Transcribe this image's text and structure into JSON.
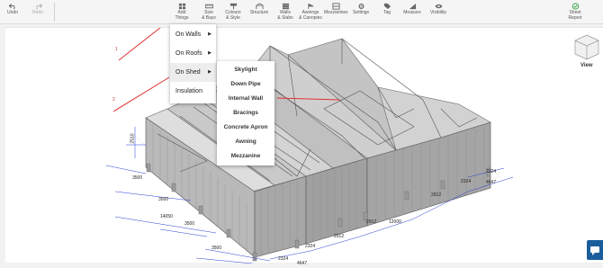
{
  "toolbar": {
    "undo": "Undo",
    "redo": "Redo",
    "add_things": [
      "Add",
      "Things"
    ],
    "size_bays": [
      "Size",
      "& Bays"
    ],
    "colours_style": [
      "Colours",
      "& Style"
    ],
    "structure": "Structure",
    "walls_slabs": [
      "Walls",
      "& Slabs"
    ],
    "awnings_canopies": [
      "Awnings",
      "& Canopies"
    ],
    "mezzanines": "Mezzanines",
    "settings": "Settings",
    "tag": "Tag",
    "measure": "Measure",
    "visibility": "Visibility",
    "sheet_report": [
      "Sheet",
      "Report"
    ]
  },
  "add_menu": {
    "items": [
      "On Walls",
      "On Roofs",
      "On Shed",
      "Insulation"
    ],
    "active_index": 2
  },
  "shed_submenu": {
    "items": [
      "Skylight",
      "Down Pipe",
      "Internal Wall",
      "Bracings",
      "Concrete Apron",
      "Awning",
      "Mezzanine"
    ]
  },
  "view_cube": {
    "label": "View"
  },
  "annotations": [
    "1",
    "2"
  ],
  "dimensions": {
    "d3500a": "3500",
    "d3500b": "3500",
    "d3500c": "3500",
    "d3500d": "3500",
    "d14050": "14050",
    "d2510": "2510",
    "d2324a": "2324",
    "d2324b": "2324",
    "d2324c": "2324",
    "d2324d": "2324",
    "d4647a": "4647",
    "d4647b": "4647",
    "d2912a": "2912",
    "d2912b": "2912",
    "d2912c": "2912",
    "d12000": "12000"
  },
  "colors": {
    "accent_red": "#e03030",
    "accent_green": "#2e9e3e",
    "dim_blue": "#2a3fd4",
    "chat_blue": "#1b5e9b"
  }
}
